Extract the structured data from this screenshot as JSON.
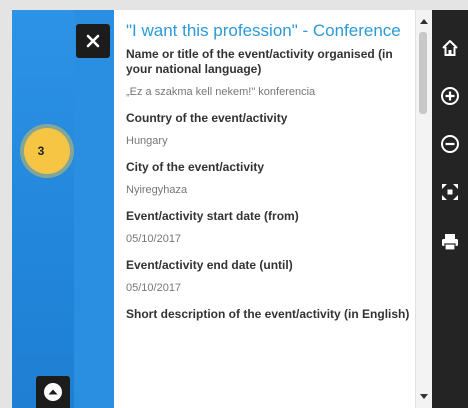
{
  "popup": {
    "title": "\"I want this profession\" - Conference",
    "fields": [
      {
        "label": "Name or title of the event/activity organised (in your national language)",
        "value": "„Ez a szakma kell nekem!\" konferencia"
      },
      {
        "label": "Country of the event/activity",
        "value": "Hungary"
      },
      {
        "label": "City of the event/activity",
        "value": "Nyiregyhaza"
      },
      {
        "label": "Event/activity start date (from)",
        "value": "05/10/2017"
      },
      {
        "label": "Event/activity end date (until)",
        "value": "05/10/2017"
      },
      {
        "label": "Short description of the event/activity (in English)",
        "value": ""
      }
    ]
  },
  "map": {
    "cluster_count": "3"
  },
  "colors": {
    "title_blue": "#2b9ad8",
    "map_blue": "#2a8fe0",
    "toolbar": "#242424",
    "cluster_yellow": "#f6c543"
  },
  "toolbar": {
    "icons": [
      "home-icon",
      "zoom-in-icon",
      "zoom-out-icon",
      "fullscreen-icon",
      "print-icon"
    ]
  }
}
